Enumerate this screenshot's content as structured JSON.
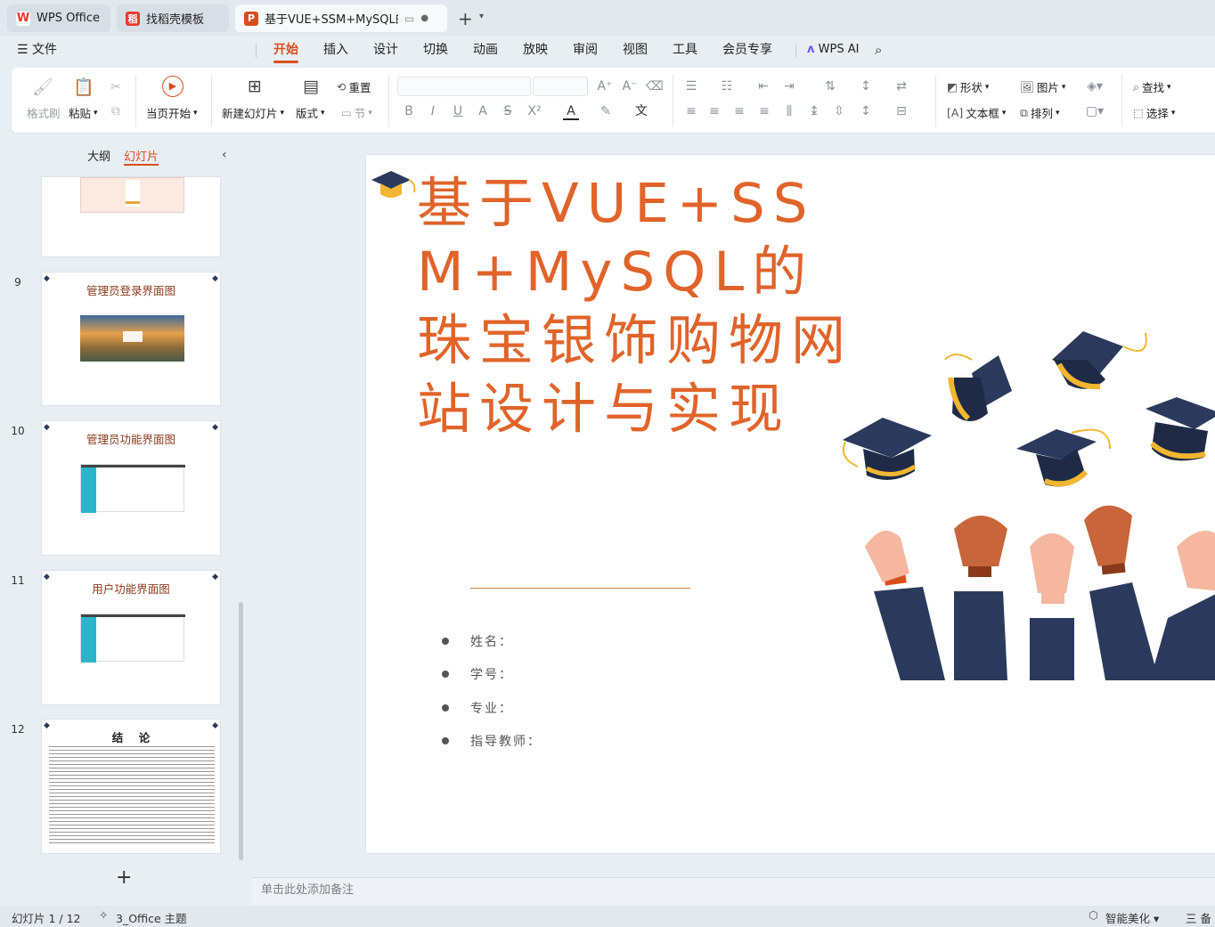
{
  "tabs": [
    {
      "label": "WPS Office"
    },
    {
      "label": "找稻壳模板"
    },
    {
      "label": "基于VUE+SSM+MySQL的珠宝"
    }
  ],
  "menu": {
    "file": "文件",
    "items": [
      "开始",
      "插入",
      "设计",
      "切换",
      "动画",
      "放映",
      "审阅",
      "视图",
      "工具",
      "会员专享"
    ],
    "ai": "WPS AI"
  },
  "ribbon": {
    "format_painter": "格式刷",
    "paste": "粘贴",
    "start_from_current": "当页开始",
    "new_slide": "新建幻灯片",
    "layout": "版式",
    "reset": "重置",
    "section": "节",
    "shape": "形状",
    "picture": "图片",
    "textbox": "文本框",
    "arrange": "排列",
    "find": "查找",
    "select": "选择"
  },
  "panel": {
    "tab_outline": "大纲",
    "tab_slides": "幻灯片",
    "slides": [
      {
        "num": "9",
        "title": "管理员登录界面图"
      },
      {
        "num": "10",
        "title": "管理员功能界面图"
      },
      {
        "num": "11",
        "title": "用户功能界面图"
      },
      {
        "num": "12",
        "title": "结    论"
      }
    ],
    "add": "+"
  },
  "slide": {
    "title": "基于VUE+SSM+MySQL的珠宝银饰购物网站设计与实现",
    "fields": [
      "姓名：",
      "学号：",
      "专业：",
      "指导教师："
    ]
  },
  "notes": "单击此处添加备注",
  "status": {
    "slide_index": "幻灯片 1 / 12",
    "theme": "3_Office 主题",
    "beautify": "智能美化",
    "right": "三 备"
  },
  "colors": {
    "accent": "#d94f1c",
    "title": "#e0642a",
    "cap": "#2b3a5c",
    "gold": "#f2b630"
  }
}
